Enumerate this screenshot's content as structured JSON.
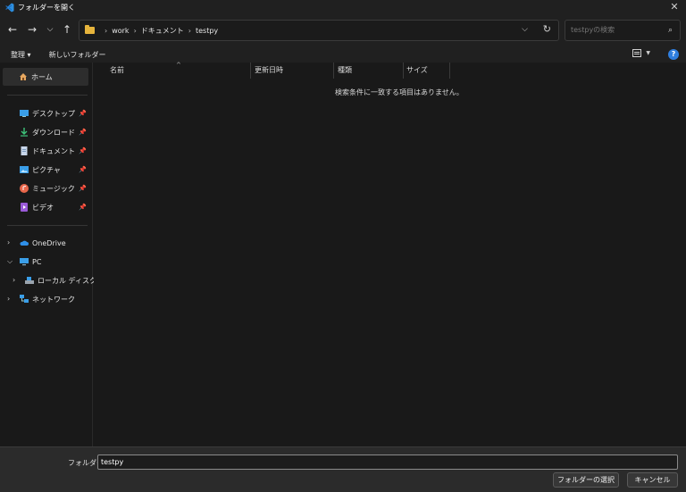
{
  "window": {
    "title": "フォルダーを開く"
  },
  "address": {
    "crumbs": [
      "work",
      "ドキュメント",
      "testpy"
    ]
  },
  "search": {
    "placeholder": "testpyの検索"
  },
  "commands": {
    "organize": "整理 ▾",
    "new_folder": "新しいフォルダー"
  },
  "sidebar": {
    "home": "ホーム",
    "quick": [
      {
        "label": "デスクトップ"
      },
      {
        "label": "ダウンロード"
      },
      {
        "label": "ドキュメント"
      },
      {
        "label": "ピクチャ"
      },
      {
        "label": "ミュージック"
      },
      {
        "label": "ビデオ"
      }
    ],
    "onedrive": "OneDrive",
    "pc": "PC",
    "local_disk": "ローカル ディスク (C:)",
    "network": "ネットワーク"
  },
  "columns": {
    "name": "名前",
    "modified": "更新日時",
    "type": "種類",
    "size": "サイズ"
  },
  "empty_message": "検索条件に一致する項目はありません。",
  "footer": {
    "folder_label": "フォルダー:",
    "folder_value": "testpy",
    "select_button": "フォルダーの選択",
    "cancel_button": "キャンセル"
  },
  "colors": {
    "accent": "#2f7fe0",
    "folder": "#e6b43c",
    "background": "#191919"
  }
}
